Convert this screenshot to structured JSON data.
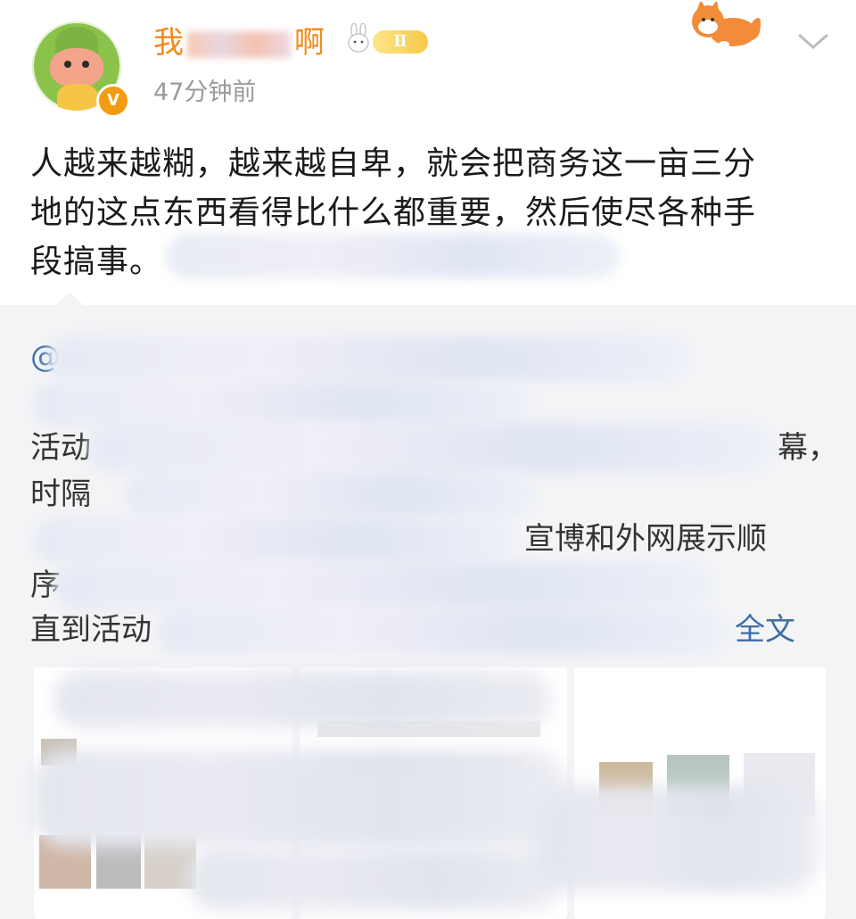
{
  "post": {
    "username_start": "我",
    "username_end": "啊",
    "rank_badge": "Ⅱ",
    "timestamp": "47分钟前",
    "text_lines": [
      "人越来越糊，越来越自卑，就会把商务这一亩三分",
      "地的这点东西看得比什么都重要，然后使尽各种手",
      "段搞事。"
    ]
  },
  "repost": {
    "mention_prefix": "@",
    "line_starts": [
      "活动",
      "时隔",
      "序",
      "直到活动"
    ],
    "line_ends": [
      "幕，",
      "",
      "",
      ""
    ],
    "visible_fragment": "宣博和外网展示顺",
    "full_text_link": "全文"
  },
  "icons": {
    "verify": "verified-v-icon",
    "rank": "rank-badge-icon",
    "more": "chevron-down-icon",
    "deco": "fox-sticker-icon"
  },
  "colors": {
    "username": "#f08a1a",
    "link": "#3f6ea5",
    "repost_bg": "#f3f4f6",
    "timestamp": "#9a9a9a"
  }
}
